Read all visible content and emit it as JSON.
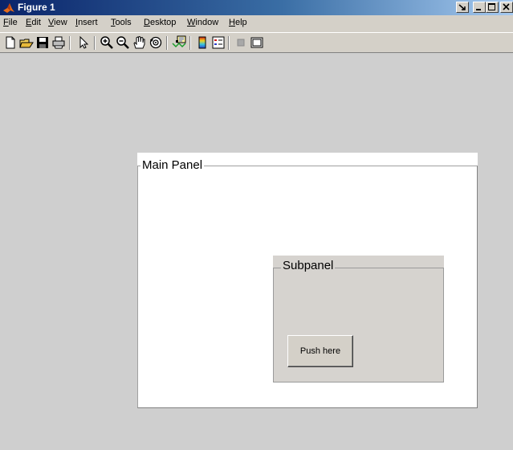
{
  "window": {
    "title": "Figure 1",
    "buttons": [
      "dock-icon",
      "minimize-icon",
      "maximize-icon",
      "close-icon"
    ]
  },
  "menubar": {
    "items": [
      {
        "label": "File",
        "u": "F",
        "rest": "ile"
      },
      {
        "label": "Edit",
        "u": "E",
        "rest": "dit"
      },
      {
        "label": "View",
        "u": "V",
        "rest": "iew"
      },
      {
        "label": "Insert",
        "u": "I",
        "rest": "nsert"
      },
      {
        "label": "Tools",
        "u": "T",
        "rest": "ools"
      },
      {
        "label": "Desktop",
        "u": "D",
        "rest": "esktop"
      },
      {
        "label": "Window",
        "u": "W",
        "rest": "indow"
      },
      {
        "label": "Help",
        "u": "H",
        "rest": "elp"
      }
    ]
  },
  "toolbar": {
    "tools": [
      "new-figure-icon",
      "open-file-icon",
      "save-icon",
      "print-icon",
      "edit-plot-arrow-icon",
      "zoom-in-icon",
      "zoom-out-icon",
      "pan-hand-icon",
      "rotate-3d-icon",
      "data-cursor-icon",
      "colorbar-icon",
      "legend-icon",
      "hide-plot-tools-icon",
      "show-plot-tools-icon"
    ]
  },
  "main_panel": {
    "title": "Main Panel"
  },
  "subpanel": {
    "title": "Subpanel",
    "button_label": "Push here"
  },
  "colors": {
    "title_bar_start": "#0a246a",
    "title_bar_end": "#a6caf0",
    "chrome": "#d4d0c8",
    "figure_bg": "#cfcfcf",
    "main_panel_bg": "#ffffff",
    "subpanel_bg": "#d6d3cf"
  }
}
